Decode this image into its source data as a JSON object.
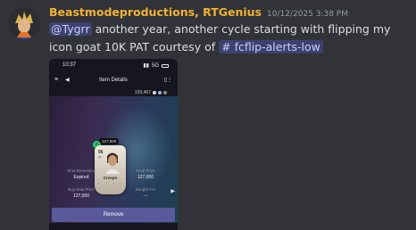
{
  "message": {
    "username": "Beastmodeproductions, RTGenius",
    "timestamp": "10/12/2025 3:38 PM",
    "mention": "@Tygrr",
    "text_after_mention": " another year, another cycle starting with flipping my icon goat 10K PAT courtesy of ",
    "channel": "fcflip-alerts-low",
    "channel_prefix": "#"
  },
  "colors": {
    "username": "#f0b232",
    "background": "#313338",
    "mention_bg": "#5865f2",
    "remove_button": "#5a5a9b"
  },
  "screenshot": {
    "status_bar": {
      "time": "10:37",
      "network": "5G"
    },
    "app_bar": {
      "title": "Item Details",
      "menu_icon": "hamburger-icon",
      "back_icon": "back-arrow-icon"
    },
    "coins": "193,467",
    "card": {
      "price_chip": "127,000",
      "rating": "96",
      "position": "CF",
      "name": "Crespo"
    },
    "info": {
      "time_remaining_label": "Time Remaining",
      "time_remaining_value": "Expired",
      "final_price_label": "Final Price",
      "final_price_value": "127,000",
      "buy_now_label": "Buy Now Price",
      "buy_now_value": "127,000",
      "bought_for_label": "Bought For",
      "bought_for_value": "---"
    },
    "remove_label": "Remove"
  }
}
